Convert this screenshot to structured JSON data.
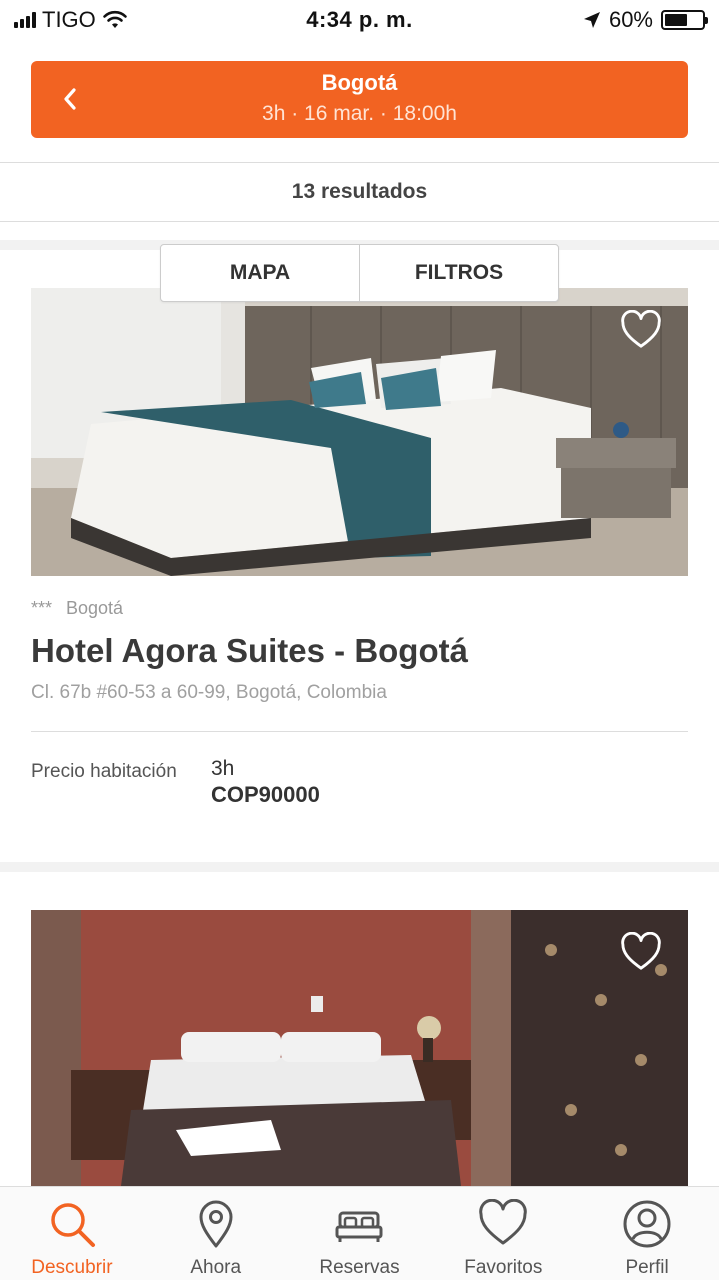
{
  "status_bar": {
    "carrier": "TIGO",
    "time": "4:34 p. m.",
    "battery": "60%",
    "battery_level": 0.6
  },
  "search": {
    "city": "Bogotá",
    "details": "3h · 16 mar. · 18:00h"
  },
  "results": {
    "count_label": "13 resultados"
  },
  "toggle": {
    "map_label": "MAPA",
    "filters_label": "FILTROS"
  },
  "hotels": [
    {
      "stars": "***",
      "city": "Bogotá",
      "name": "Hotel Agora Suites - Bogotá",
      "address": "Cl. 67b #60-53 a 60-99, Bogotá, Colombia",
      "price_label": "Precio habitación",
      "duration": "3h",
      "price": "COP90000"
    }
  ],
  "nav": {
    "items": [
      {
        "label": "Descubrir",
        "icon": "search-icon",
        "active": true
      },
      {
        "label": "Ahora",
        "icon": "location-pin-icon",
        "active": false
      },
      {
        "label": "Reservas",
        "icon": "bed-icon",
        "active": false
      },
      {
        "label": "Favoritos",
        "icon": "heart-icon",
        "active": false
      },
      {
        "label": "Perfil",
        "icon": "user-icon",
        "active": false
      }
    ]
  },
  "colors": {
    "accent": "#f26322",
    "text_dark": "#333333",
    "text_muted": "#a0a0a0"
  }
}
